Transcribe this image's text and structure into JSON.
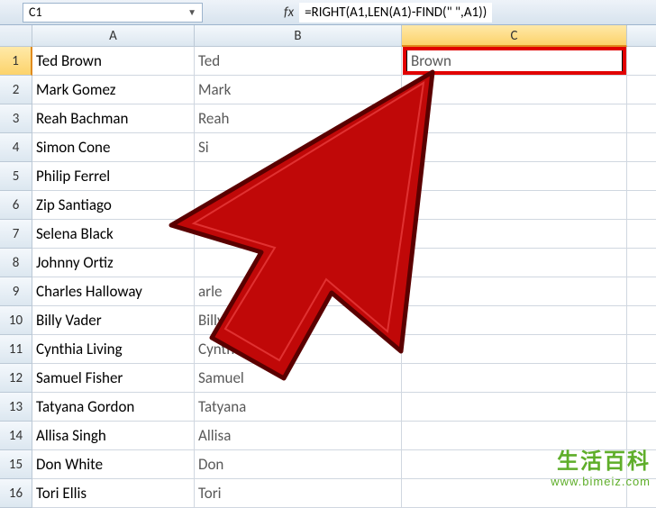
{
  "formula_bar": {
    "cell_ref": "C1",
    "fx_label": "fx",
    "formula": "=RIGHT(A1,LEN(A1)-FIND(\" \",A1))"
  },
  "columns": [
    "A",
    "B",
    "C",
    ""
  ],
  "selected_column_index": 2,
  "selected_row_index": 0,
  "rows": [
    {
      "n": "1",
      "a": "Ted Brown",
      "b": "Ted",
      "c": "Brown"
    },
    {
      "n": "2",
      "a": "Mark Gomez",
      "b": "Mark",
      "c": ""
    },
    {
      "n": "3",
      "a": "Reah Bachman",
      "b": "Reah",
      "c": ""
    },
    {
      "n": "4",
      "a": "Simon Cone",
      "b": "Si",
      "c": ""
    },
    {
      "n": "5",
      "a": "Philip Ferrel",
      "b": "",
      "c": ""
    },
    {
      "n": "6",
      "a": "Zip Santiago",
      "b": "",
      "c": ""
    },
    {
      "n": "7",
      "a": "Selena Black",
      "b": "",
      "c": ""
    },
    {
      "n": "8",
      "a": "Johnny Ortiz",
      "b": "",
      "c": ""
    },
    {
      "n": "9",
      "a": "Charles Halloway",
      "b": "arle",
      "c": ""
    },
    {
      "n": "10",
      "a": "Billy Vader",
      "b": "Billy",
      "c": ""
    },
    {
      "n": "11",
      "a": "Cynthia Living",
      "b": "Cyntha",
      "c": ""
    },
    {
      "n": "12",
      "a": "Samuel Fisher",
      "b": "Samuel",
      "c": ""
    },
    {
      "n": "13",
      "a": "Tatyana Gordon",
      "b": "Tatyana",
      "c": ""
    },
    {
      "n": "14",
      "a": "Allisa Singh",
      "b": "Allisa",
      "c": ""
    },
    {
      "n": "15",
      "a": "Don White",
      "b": "Don",
      "c": ""
    },
    {
      "n": "16",
      "a": "Tori Ellis",
      "b": "Tori",
      "c": ""
    }
  ],
  "watermark": {
    "cn": "生活百科",
    "url": "www.bimeiz.com"
  }
}
